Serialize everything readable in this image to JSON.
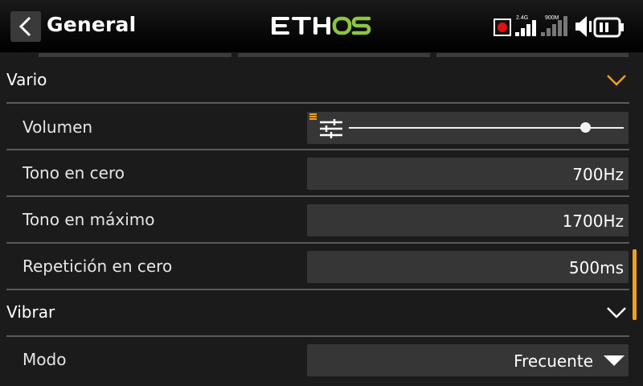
{
  "header": {
    "title": "General",
    "logo_text": "ETHOS",
    "status": {
      "rf_24g": "2.4G",
      "rf_900m": "900M"
    },
    "icons": [
      "back-arrow-icon",
      "record-icon",
      "signal-2-4g-icon",
      "signal-900m-icon",
      "speaker-icon",
      "battery-icon"
    ]
  },
  "sections": {
    "vario": {
      "label": "Vario"
    },
    "vibrar": {
      "label": "Vibrar"
    }
  },
  "rows": {
    "volumen": {
      "label": "Volumen",
      "level": 0.86
    },
    "tono_cero": {
      "label": "Tono en cero",
      "value": "700Hz"
    },
    "tono_max": {
      "label": "Tono en máximo",
      "value": "1700Hz"
    },
    "repeticion": {
      "label": "Repetición en cero",
      "value": "500ms"
    },
    "modo": {
      "label": "Modo",
      "value": "Frecuente"
    }
  },
  "colors": {
    "accent": "#f0a020",
    "logo_green": "#8dc63f",
    "field_bg": "#363636",
    "background": "#1b1b1b"
  }
}
